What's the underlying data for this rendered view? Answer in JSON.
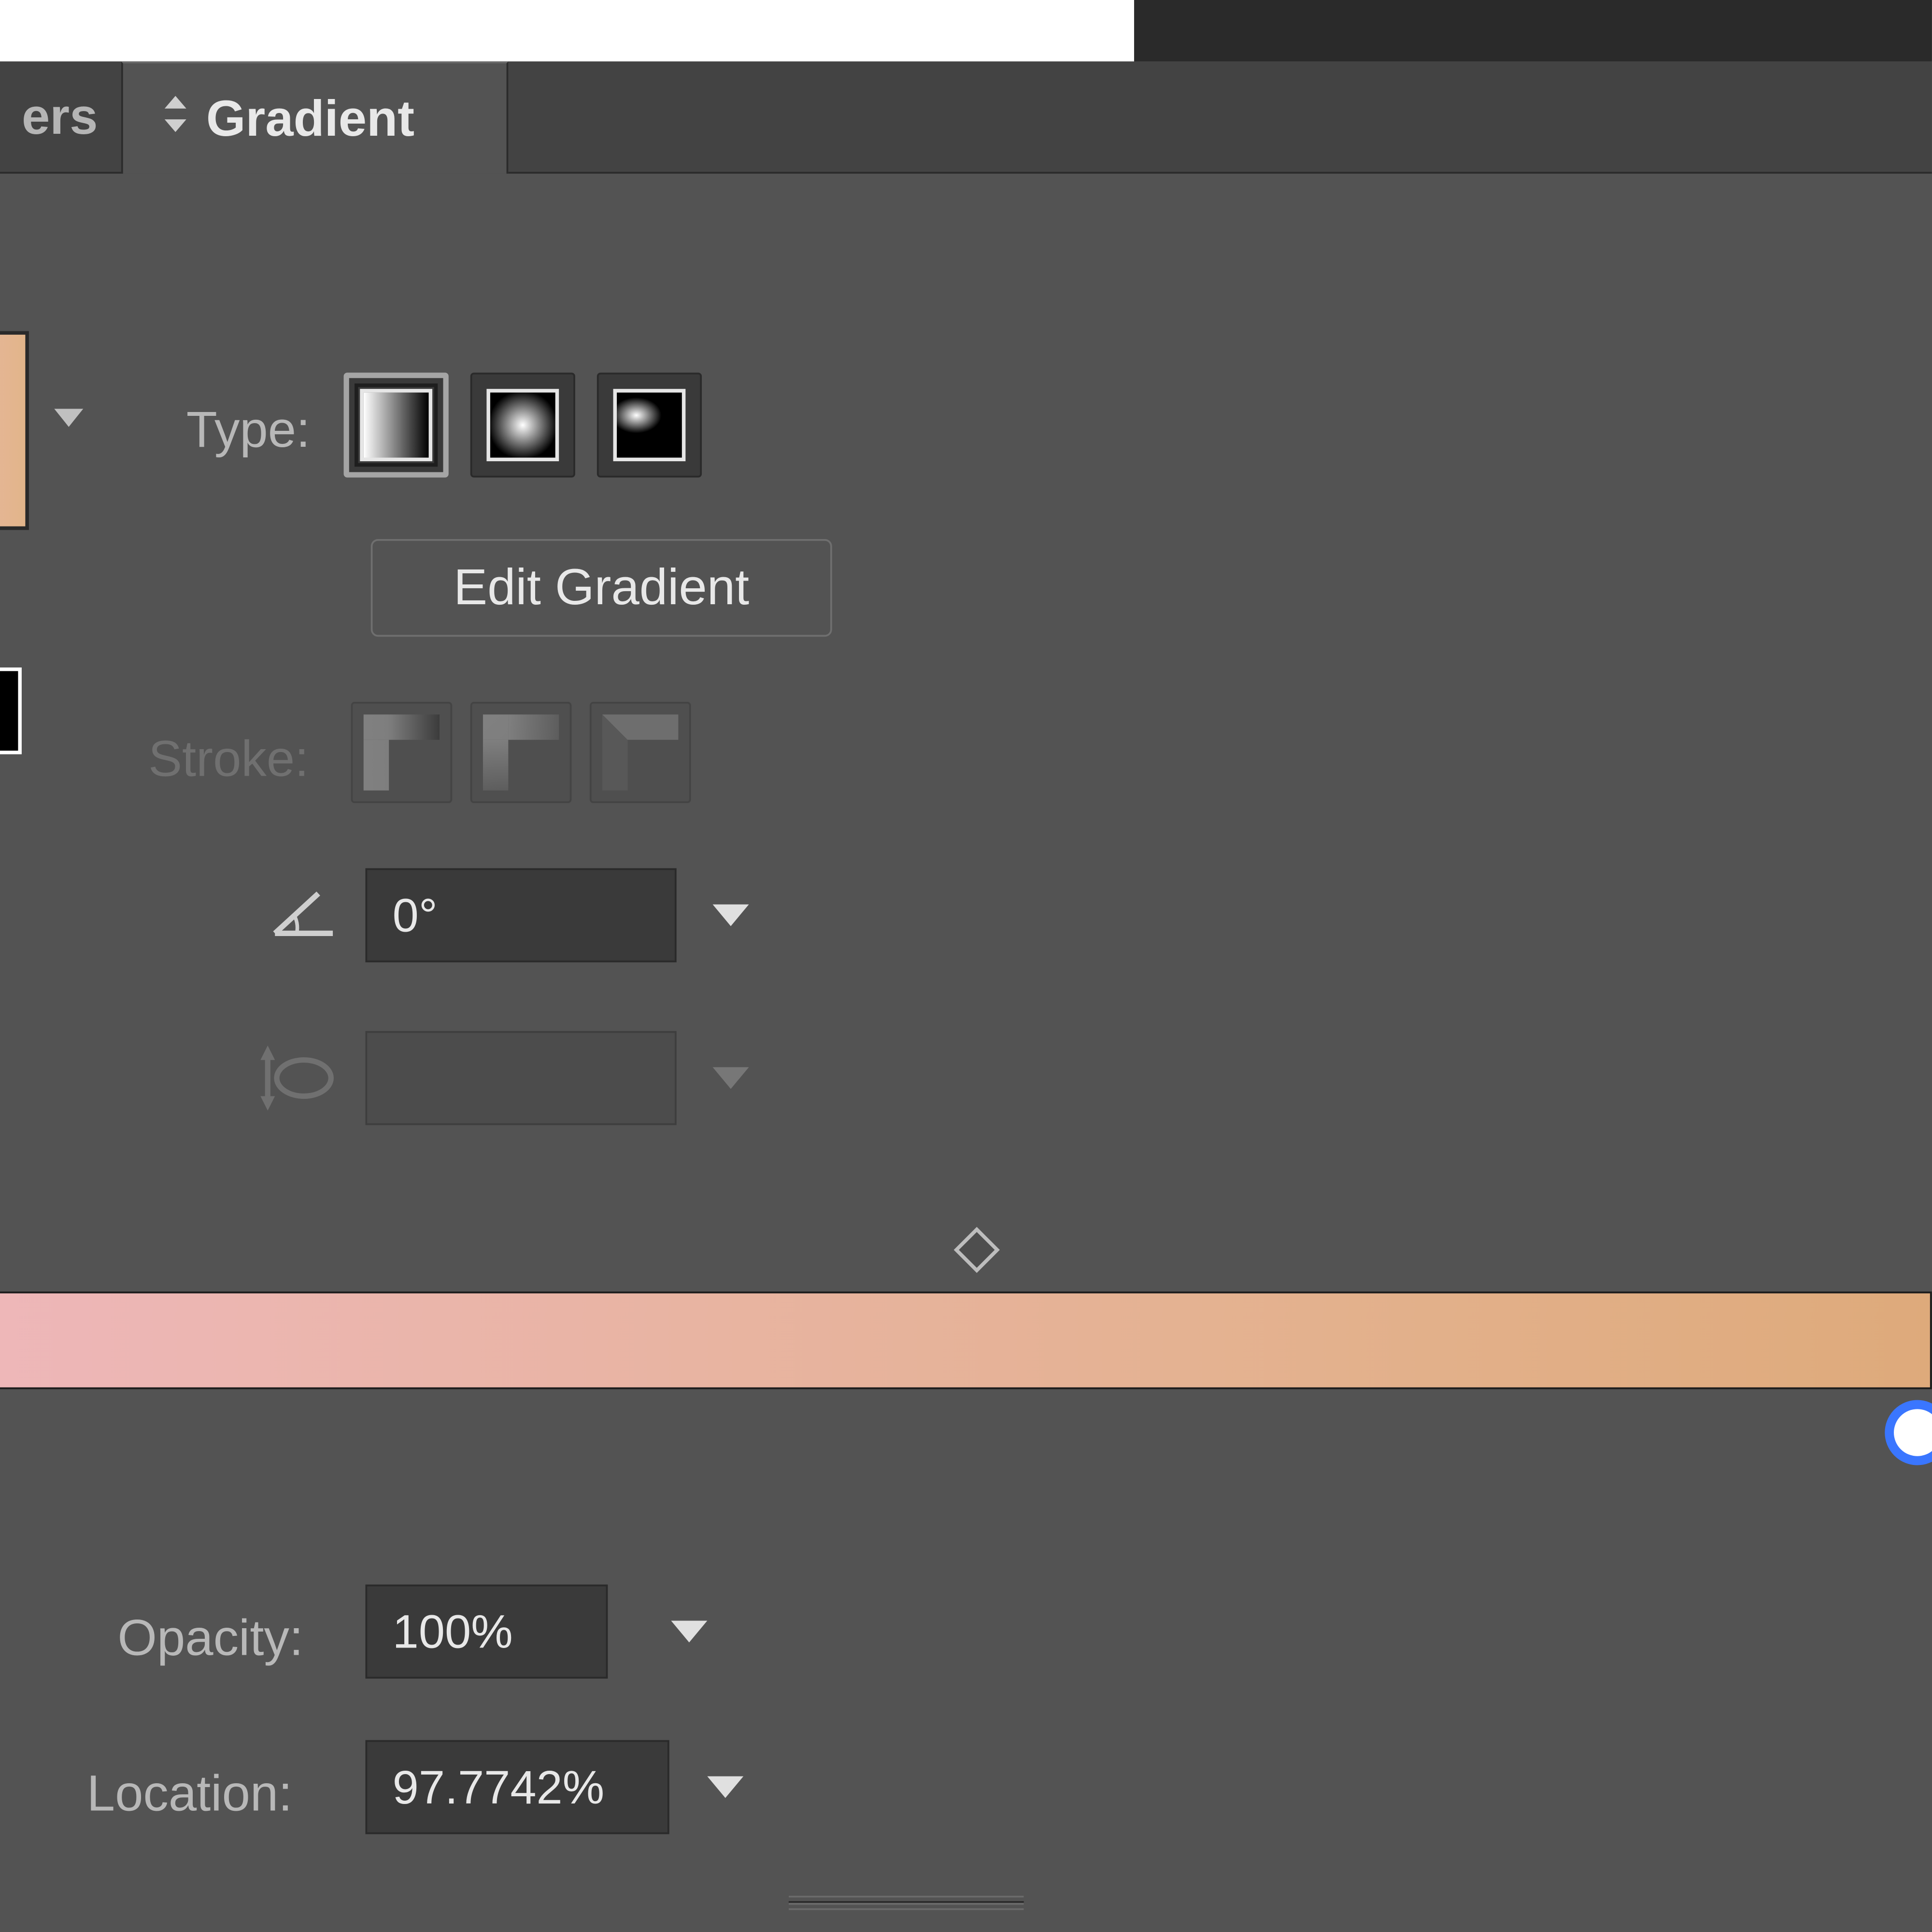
{
  "tabs": {
    "other": "ers",
    "active": "Gradient"
  },
  "type": {
    "label": "Type:"
  },
  "edit_button": "Edit Gradient",
  "stroke": {
    "label": "Stroke:"
  },
  "angle": {
    "value": "0°"
  },
  "opacity": {
    "label": "Opacity:",
    "value": "100%"
  },
  "location": {
    "label": "Location:",
    "value": "97.7742%"
  }
}
